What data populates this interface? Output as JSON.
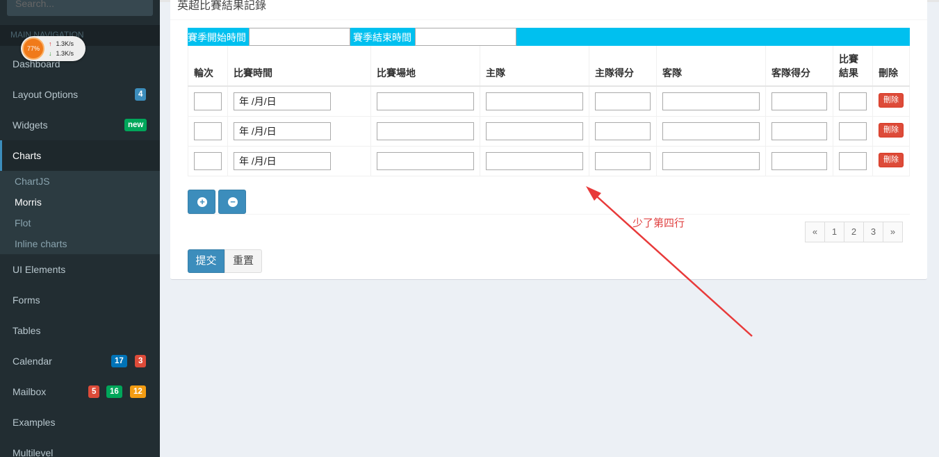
{
  "sidebar": {
    "search_placeholder": "Search...",
    "nav_header": "MAIN NAVIGATION",
    "items": [
      {
        "label": "Dashboard"
      },
      {
        "label": "Layout Options",
        "badge": "4"
      },
      {
        "label": "Widgets",
        "badge": "new"
      },
      {
        "label": "Charts"
      },
      {
        "label": "UI Elements"
      },
      {
        "label": "Forms"
      },
      {
        "label": "Tables"
      },
      {
        "label": "Calendar",
        "badges": [
          "17",
          "3"
        ]
      },
      {
        "label": "Mailbox",
        "badges": [
          "5",
          "16",
          "12"
        ]
      },
      {
        "label": "Examples"
      },
      {
        "label": "Multilevel"
      }
    ],
    "submenu": [
      "ChartJS",
      "Morris",
      "Flot",
      "Inline charts"
    ]
  },
  "speed_widget": {
    "percent": "77%",
    "up": "1.3K/s",
    "down": "1.3K/s",
    "up_arrow": "↑",
    "down_arrow": "↓"
  },
  "box": {
    "title": "英超比賽結果記錄",
    "season_start_label": "賽季開始時間",
    "season_end_label": "賽季結束時間",
    "columns": [
      "輪次",
      "比賽時間",
      "比賽場地",
      "主隊",
      "主隊得分",
      "客隊",
      "客隊得分",
      "比賽",
      "結果",
      "刪除"
    ],
    "date_placeholder": "年 /月/日",
    "delete_label": "刪除",
    "add_icon": "+",
    "remove_icon": "−",
    "pagination": [
      "«",
      "1",
      "2",
      "3",
      "»"
    ],
    "submit_label": "提交",
    "reset_label": "重置"
  },
  "annotation": {
    "text": "少了第四行",
    "color": "#e04040"
  }
}
